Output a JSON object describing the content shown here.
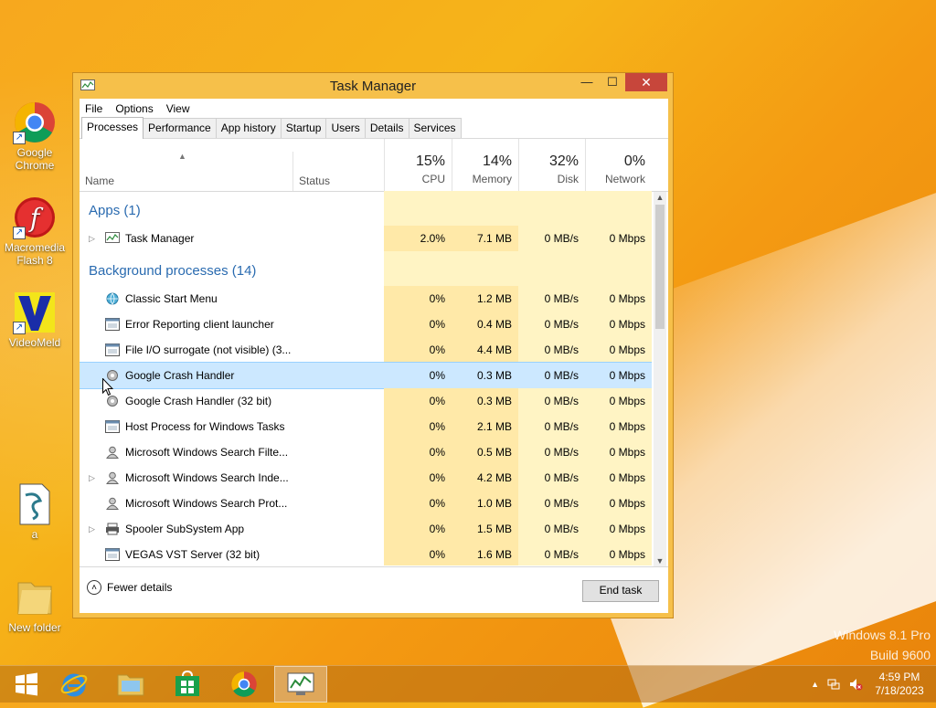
{
  "desktop": {
    "icons": [
      {
        "label": "Google\nChrome",
        "line1": "Google",
        "line2": "Chrome"
      },
      {
        "line1": "Macromedia",
        "line2": "Flash 8"
      },
      {
        "line1": "VideoMeld",
        "line2": ""
      },
      {
        "line1": "a",
        "line2": ""
      },
      {
        "line1": "New folder",
        "line2": ""
      }
    ],
    "watermark": {
      "line1": "Windows 8.1 Pro",
      "line2": "Build 9600"
    }
  },
  "window": {
    "title": "Task Manager",
    "minimize": "—",
    "maximize": "☐",
    "close": "✕",
    "menu": [
      "File",
      "Options",
      "View"
    ],
    "tabs": [
      "Processes",
      "Performance",
      "App history",
      "Startup",
      "Users",
      "Details",
      "Services"
    ],
    "selected_tab": "Processes",
    "columns": {
      "name": "Name",
      "status": "Status",
      "cpu": {
        "pct": "15%",
        "label": "CPU"
      },
      "memory": {
        "pct": "14%",
        "label": "Memory"
      },
      "disk": {
        "pct": "32%",
        "label": "Disk"
      },
      "network": {
        "pct": "0%",
        "label": "Network"
      }
    },
    "groups": {
      "apps": "Apps (1)",
      "background": "Background processes (14)"
    },
    "apps": [
      {
        "name": "Task Manager",
        "cpu": "2.0%",
        "mem": "7.1 MB",
        "disk": "0 MB/s",
        "net": "0 Mbps"
      }
    ],
    "background": [
      {
        "name": "Classic Start Menu",
        "cpu": "0%",
        "mem": "1.2 MB",
        "disk": "0 MB/s",
        "net": "0 Mbps"
      },
      {
        "name": "Error Reporting client launcher",
        "cpu": "0%",
        "mem": "0.4 MB",
        "disk": "0 MB/s",
        "net": "0 Mbps"
      },
      {
        "name": "File I/O surrogate (not visible) (3...",
        "cpu": "0%",
        "mem": "4.4 MB",
        "disk": "0 MB/s",
        "net": "0 Mbps"
      },
      {
        "name": "Google Crash Handler",
        "cpu": "0%",
        "mem": "0.3 MB",
        "disk": "0 MB/s",
        "net": "0 Mbps"
      },
      {
        "name": "Google Crash Handler (32 bit)",
        "cpu": "0%",
        "mem": "0.3 MB",
        "disk": "0 MB/s",
        "net": "0 Mbps"
      },
      {
        "name": "Host Process for Windows Tasks",
        "cpu": "0%",
        "mem": "2.1 MB",
        "disk": "0 MB/s",
        "net": "0 Mbps"
      },
      {
        "name": "Microsoft Windows Search Filte...",
        "cpu": "0%",
        "mem": "0.5 MB",
        "disk": "0 MB/s",
        "net": "0 Mbps"
      },
      {
        "name": "Microsoft Windows Search Inde...",
        "cpu": "0%",
        "mem": "4.2 MB",
        "disk": "0 MB/s",
        "net": "0 Mbps"
      },
      {
        "name": "Microsoft Windows Search Prot...",
        "cpu": "0%",
        "mem": "1.0 MB",
        "disk": "0 MB/s",
        "net": "0 Mbps"
      },
      {
        "name": "Spooler SubSystem App",
        "cpu": "0%",
        "mem": "1.5 MB",
        "disk": "0 MB/s",
        "net": "0 Mbps"
      },
      {
        "name": "VEGAS VST Server (32 bit)",
        "cpu": "0%",
        "mem": "1.6 MB",
        "disk": "0 MB/s",
        "net": "0 Mbps"
      }
    ],
    "fewer_details": "Fewer details",
    "end_task": "End task"
  },
  "taskbar": {
    "clock_time": "4:59 PM",
    "clock_date": "7/18/2023"
  },
  "colors": {
    "accent": "#2a6bb0",
    "selection": "#cce8ff",
    "close": "#c7463b"
  }
}
